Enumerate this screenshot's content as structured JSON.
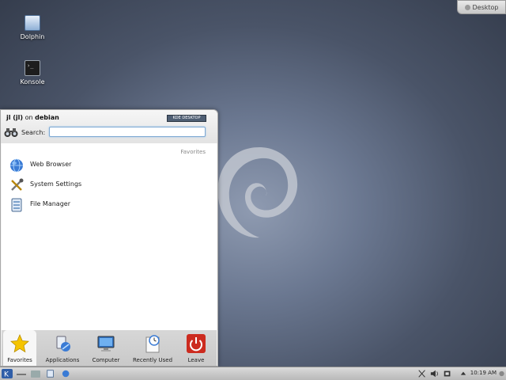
{
  "desktop": {
    "icons": [
      {
        "label": "Dolphin",
        "icon": "dolphin-icon"
      },
      {
        "label": "Konsole",
        "icon": "konsole-icon"
      }
    ],
    "toolbox_label": "Desktop"
  },
  "launcher": {
    "user_prefix": "jl (jl)",
    "user_on": "on",
    "host": "debian",
    "badge": "KDE DESKTOP",
    "search_label": "Search:",
    "search_value": "",
    "section_title": "Favorites",
    "favorites": [
      {
        "label": "Web Browser",
        "icon": "globe-icon"
      },
      {
        "label": "System Settings",
        "icon": "settings-tools-icon"
      },
      {
        "label": "File Manager",
        "icon": "file-manager-icon"
      }
    ],
    "tabs": [
      {
        "label": "Favorites",
        "icon": "star-icon"
      },
      {
        "label": "Applications",
        "icon": "applications-icon"
      },
      {
        "label": "Computer",
        "icon": "computer-icon"
      },
      {
        "label": "Recently Used",
        "icon": "clock-icon"
      },
      {
        "label": "Leave",
        "icon": "power-icon"
      }
    ]
  },
  "panel": {
    "clock": "10:19 AM"
  },
  "colors": {
    "accent": "#3a7bd5",
    "leave_red": "#cc2b1f",
    "star_yellow": "#f5c400"
  }
}
